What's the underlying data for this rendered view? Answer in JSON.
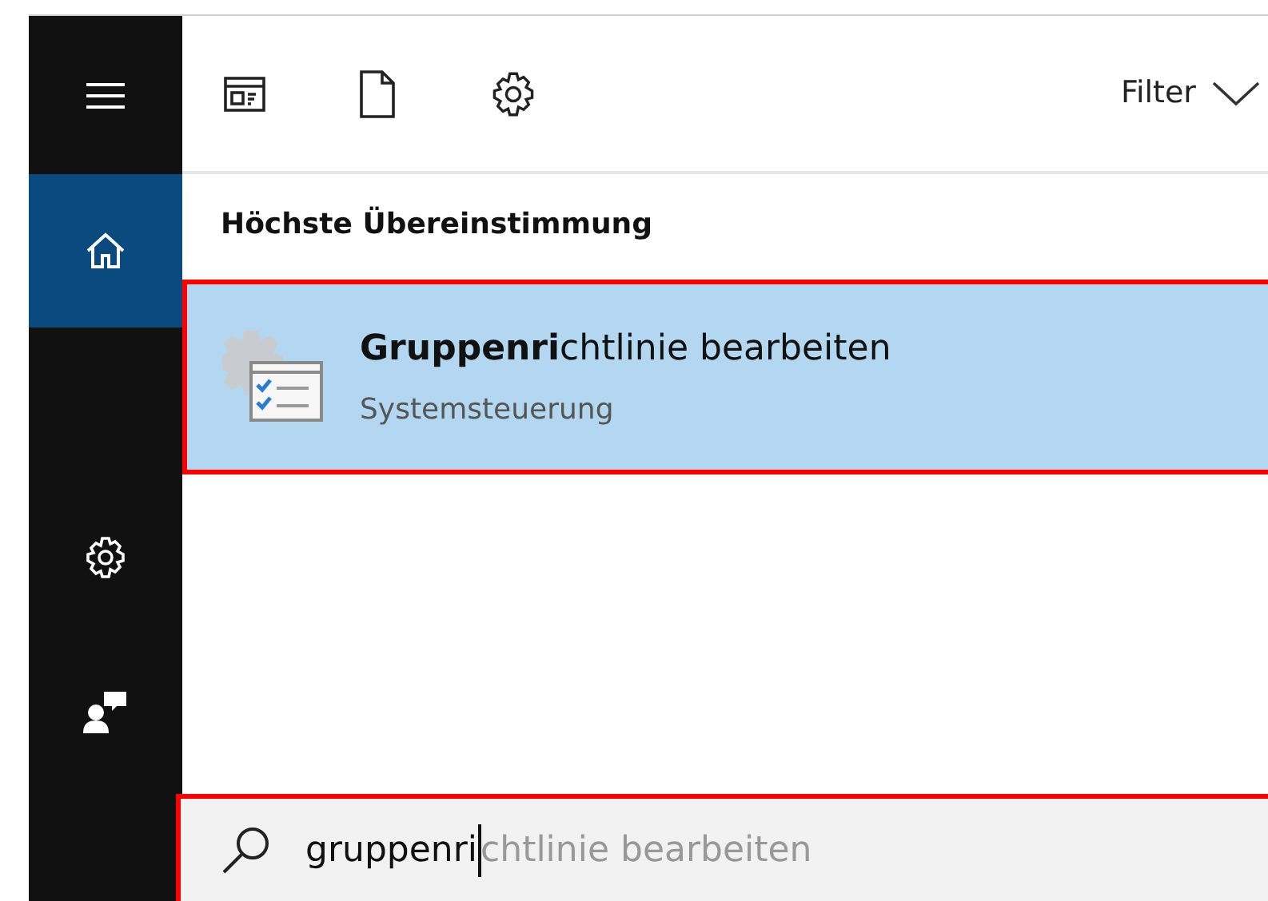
{
  "sidebar": {
    "items": [
      {
        "kind": "menu",
        "selected": false
      },
      {
        "kind": "home",
        "selected": true
      },
      {
        "kind": "settings",
        "selected": false
      },
      {
        "kind": "feedback",
        "selected": false
      }
    ]
  },
  "toolbar": {
    "icons": [
      {
        "kind": "apps"
      },
      {
        "kind": "document"
      },
      {
        "kind": "settings"
      }
    ],
    "filter": "Filter"
  },
  "section_heading": "Höchste Übereinstimmung",
  "result": {
    "title": "**Gruppenri**chtlinie bearbeiten",
    "subtitle": "Systemsteuerung",
    "selected": true
  },
  "search": {
    "value": "gruppenri",
    "suggestion": "chtlinie bearbeiten"
  }
}
